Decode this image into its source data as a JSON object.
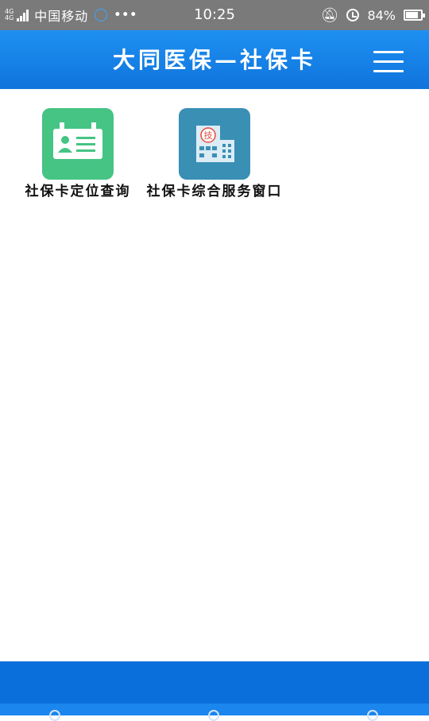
{
  "status_bar": {
    "network_top": "4G",
    "network_bottom": "4G",
    "carrier": "中国移动",
    "more": "•••",
    "time": "10:25",
    "battery": "84%",
    "battery_level": 0.84
  },
  "header": {
    "title": "大同医保—社保卡"
  },
  "tiles": [
    {
      "label": "社保卡定位查询",
      "color": "#45c484",
      "icon": "id-card-icon"
    },
    {
      "label": "社保卡综合服务窗口",
      "color": "#3a8fb4",
      "icon": "building-icon"
    }
  ],
  "colors": {
    "header": "#1380e6",
    "footer": "#0b6fdb",
    "status_bar": "#7a7a7a"
  }
}
